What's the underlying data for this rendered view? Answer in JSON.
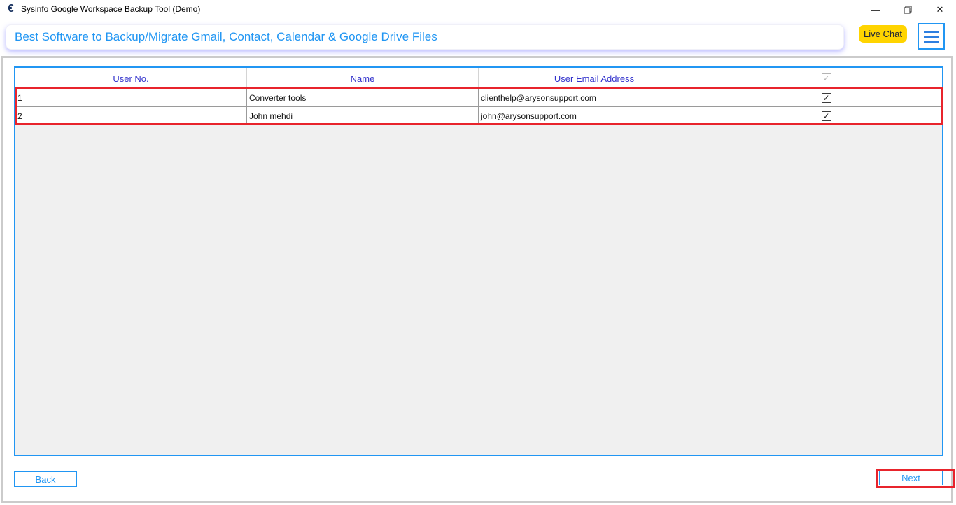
{
  "window": {
    "title": "Sysinfo Google Workspace Backup Tool (Demo)",
    "app_icon_glyph": "€",
    "controls": {
      "minimize_glyph": "—",
      "close_glyph": "✕"
    }
  },
  "header": {
    "banner_text": "Best Software to Backup/Migrate Gmail, Contact, Calendar & Google Drive Files",
    "live_chat_label": "Live Chat"
  },
  "table": {
    "columns": [
      "User No.",
      "Name",
      "User Email Address"
    ],
    "header_checkbox_checked": true,
    "rows": [
      {
        "no": "1",
        "name": "Converter tools",
        "email": "clienthelp@arysonsupport.com",
        "checked": true
      },
      {
        "no": "2",
        "name": "John mehdi",
        "email": "john@arysonsupport.com",
        "checked": true
      }
    ]
  },
  "icons": {
    "check_glyph": "✓"
  },
  "footer": {
    "back_label": "Back",
    "next_label": "Next"
  },
  "colors": {
    "accent_blue": "#2196f3",
    "column_header_blue": "#3333cc",
    "annotation_red": "#e8242c",
    "live_chat_yellow": "#ffd400",
    "frame_gray": "#cbcbcb",
    "panel_gray": "#f0f0f0"
  }
}
